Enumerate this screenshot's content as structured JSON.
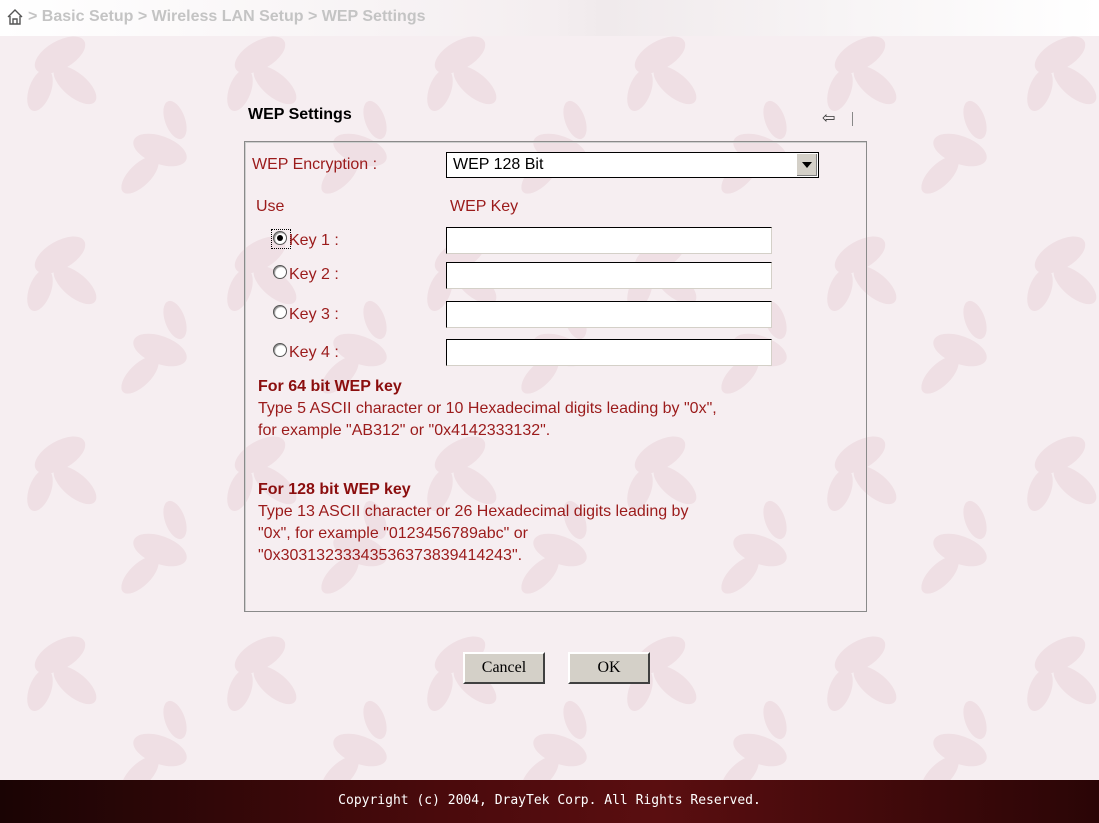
{
  "breadcrumb": {
    "items": [
      "Basic Setup",
      "Wireless LAN Setup",
      "WEP Settings"
    ],
    "separator": ">"
  },
  "page": {
    "title": "WEP Settings"
  },
  "form": {
    "encryption_label": "WEP Encryption :",
    "encryption_value": "WEP 128 Bit",
    "use_header": "Use",
    "key_header": "WEP Key",
    "keys": [
      {
        "label": "Key 1 :",
        "selected": true,
        "value": ""
      },
      {
        "label": "Key 2 :",
        "selected": false,
        "value": ""
      },
      {
        "label": "Key 3 :",
        "selected": false,
        "value": ""
      },
      {
        "label": "Key 4 :",
        "selected": false,
        "value": ""
      }
    ]
  },
  "help": {
    "h64_title": "For 64 bit WEP key",
    "h64_line1": "Type 5 ASCII character or 10 Hexadecimal digits leading by \"0x\",",
    "h64_line2": "for example \"AB312\" or \"0x4142333132\".",
    "h128_title": "For 128 bit WEP key",
    "h128_line1": "Type 13 ASCII character or 26 Hexadecimal digits leading by",
    "h128_line2": "\"0x\", for example \"0123456789abc\" or",
    "h128_line3": "\"0x30313233343536373839414243\"."
  },
  "buttons": {
    "cancel": "Cancel",
    "ok": "OK"
  },
  "footer": {
    "copyright": "Copyright (c) 2004, DrayTek Corp. All Rights Reserved."
  },
  "icons": {
    "home": "home-icon",
    "back": "back-arrow-icon"
  },
  "colors": {
    "label": "#9b1b1b",
    "footer_bg": "#4a0a0c",
    "page_bg": "#f6eef1"
  }
}
